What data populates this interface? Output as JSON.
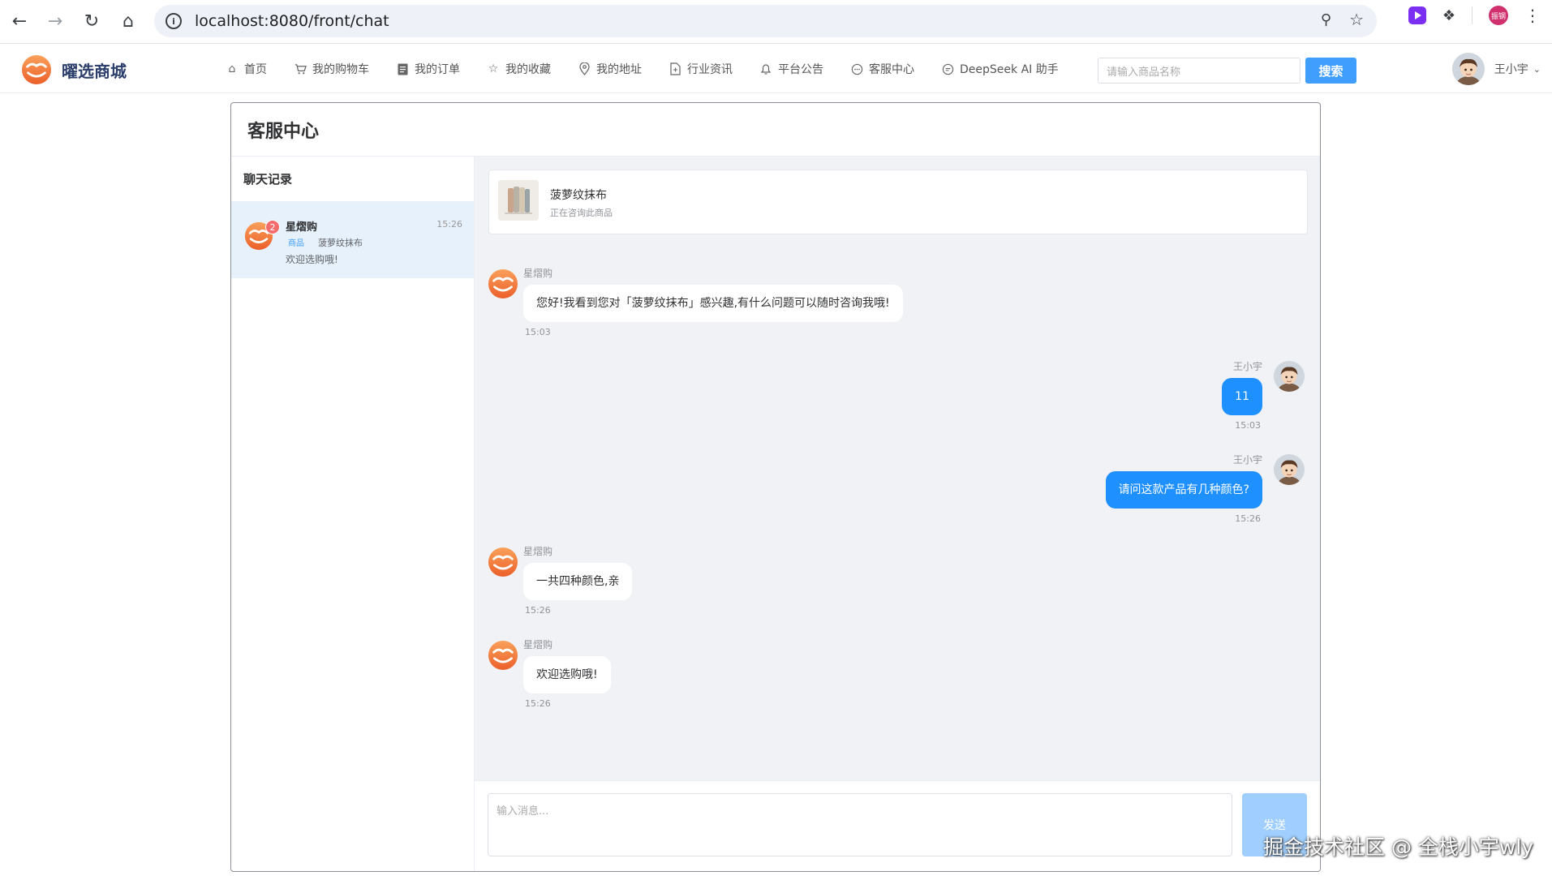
{
  "browser": {
    "url": "localhost:8080/front/chat",
    "profile_label": "振钢"
  },
  "site": {
    "logo_text": "曜选商城",
    "nav": [
      {
        "label": "首页",
        "icon": "home-icon"
      },
      {
        "label": "我的购物车",
        "icon": "cart-icon"
      },
      {
        "label": "我的订单",
        "icon": "order-icon"
      },
      {
        "label": "我的收藏",
        "icon": "star-icon"
      },
      {
        "label": "我的地址",
        "icon": "location-icon"
      },
      {
        "label": "行业资讯",
        "icon": "document-icon"
      },
      {
        "label": "平台公告",
        "icon": "bell-icon"
      },
      {
        "label": "客服中心",
        "icon": "chat-icon"
      },
      {
        "label": "DeepSeek AI 助手",
        "icon": "chat-bubble-icon"
      }
    ],
    "search_placeholder": "请输入商品名称",
    "search_button": "搜索",
    "user_name": "王小宇"
  },
  "service": {
    "title": "客服中心",
    "sidebar_title": "聊天记录",
    "session": {
      "name": "星熠购",
      "time": "15:26",
      "badge": "2",
      "tag": "商品",
      "product": "菠萝纹抹布",
      "last_message": "欢迎选购哦!"
    },
    "product_card": {
      "name": "菠萝纹抹布",
      "subtitle": "正在咨询此商品"
    },
    "messages": [
      {
        "sender": "星熠购",
        "text": "您好!我看到您对「菠萝纹抹布」感兴趣,有什么问题可以随时咨询我哦!",
        "time": "15:03",
        "side": "in"
      },
      {
        "sender": "王小宇",
        "text": "11",
        "time": "15:03",
        "side": "out"
      },
      {
        "sender": "王小宇",
        "text": "请问这款产品有几种颜色?",
        "time": "15:26",
        "side": "out"
      },
      {
        "sender": "星熠购",
        "text": "一共四种颜色,亲",
        "time": "15:26",
        "side": "in"
      },
      {
        "sender": "星熠购",
        "text": "欢迎选购哦!",
        "time": "15:26",
        "side": "in"
      }
    ],
    "input_placeholder": "输入消息...",
    "send_button": "发送"
  },
  "watermark": "掘金技术社区 @ 全栈小宇wly",
  "colors": {
    "accent": "#409eff",
    "bubble_out": "#1e90ff",
    "chat_bg": "#f0f2f5",
    "session_active": "#e6f1fc",
    "badge": "#f56c6c",
    "brand_orange": "#f07a3a"
  }
}
